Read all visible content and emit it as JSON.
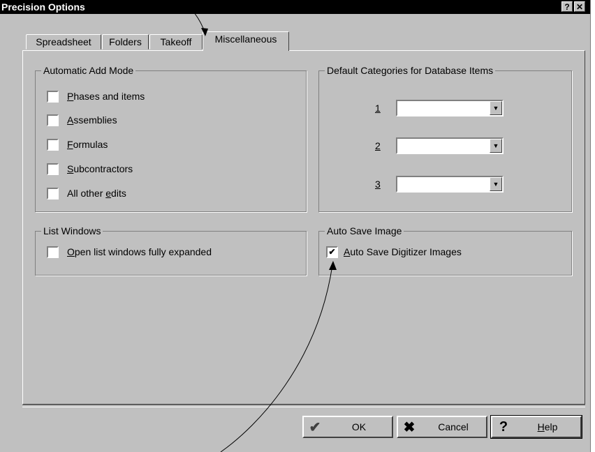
{
  "window": {
    "title": "Precision Options",
    "help_glyph": "?",
    "close_glyph": "✕"
  },
  "tabs": [
    {
      "label": "Spreadsheet",
      "active": false
    },
    {
      "label": "Folders",
      "active": false
    },
    {
      "label": "Takeoff",
      "active": false
    },
    {
      "label": "Miscellaneous",
      "active": true
    }
  ],
  "automatic_add_mode": {
    "title": "Automatic Add Mode",
    "items": [
      {
        "pre": "",
        "key": "P",
        "post": "hases and items",
        "checked": false
      },
      {
        "pre": "",
        "key": "A",
        "post": "ssemblies",
        "checked": false
      },
      {
        "pre": "",
        "key": "F",
        "post": "ormulas",
        "checked": false
      },
      {
        "pre": "",
        "key": "S",
        "post": "ubcontractors",
        "checked": false
      },
      {
        "pre": "All other ",
        "key": "e",
        "post": "dits",
        "checked": false
      }
    ]
  },
  "default_categories": {
    "title": "Default Categories for Database Items",
    "rows": [
      {
        "num": "1",
        "value": ""
      },
      {
        "num": "2",
        "value": ""
      },
      {
        "num": "3",
        "value": ""
      }
    ]
  },
  "list_windows": {
    "title": "List Windows",
    "item": {
      "pre": "",
      "key": "O",
      "post": "pen list windows fully expanded",
      "checked": false
    }
  },
  "auto_save_image": {
    "title": "Auto Save Image",
    "item": {
      "pre": "",
      "key": "A",
      "post": "uto Save Digitizer Images",
      "checked": true
    }
  },
  "buttons": {
    "ok": {
      "label": "OK",
      "icon": "checkmark-icon"
    },
    "cancel": {
      "label": "Cancel",
      "icon": "x-icon"
    },
    "help": {
      "pre": "",
      "key": "H",
      "post": "elp",
      "icon": "question-icon"
    }
  },
  "colors": {
    "face": "#c0c0c0",
    "titlebar": "#000000",
    "ok_icon": "#404040"
  }
}
